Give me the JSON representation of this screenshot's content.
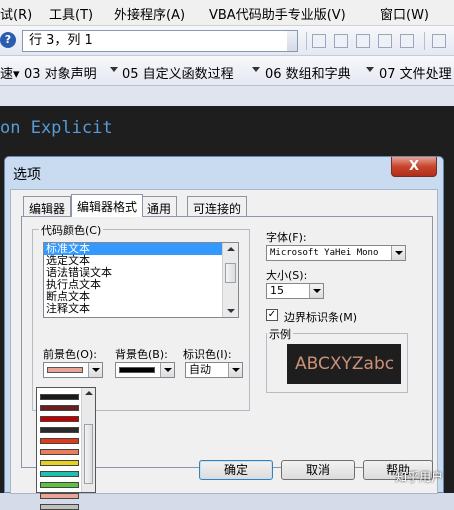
{
  "menubar": {
    "items": [
      "试(R)",
      "工具(T)",
      "外接程序(A)",
      "VBA代码助手专业版(V)",
      "窗口(W)"
    ]
  },
  "toolbar1": {
    "help_glyph": "?",
    "position_text": "行 3，列 1"
  },
  "toolbar2": {
    "items": [
      "速▾",
      "03 对象声明",
      "05 自定义函数过程",
      "06 数组和字典",
      "07 文件处理"
    ]
  },
  "editor": {
    "code_visible": "on Explicit"
  },
  "dialog": {
    "title": "选项",
    "close_glyph": "X",
    "tabs": [
      "编辑器",
      "编辑器格式",
      "通用",
      "可连接的"
    ],
    "active_tab": 1,
    "code_colors": {
      "group_label": "代码颜色(C)",
      "items": [
        "标准文本",
        "选定文本",
        "语法错误文本",
        "执行点文本",
        "断点文本",
        "注释文本"
      ],
      "selected_index": 0
    },
    "foreground": {
      "label": "前景色(O):",
      "swatch_color": "#e8a494"
    },
    "background": {
      "label": "背景色(B):",
      "swatch_color": "#000000"
    },
    "indicator": {
      "label": "标识色(I):",
      "value": "自动"
    },
    "font": {
      "label": "字体(F):",
      "value": "Microsoft YaHei Mono"
    },
    "size": {
      "label": "大小(S):",
      "value": "15"
    },
    "margin_indicator": {
      "label": "边界标识条(M)",
      "checked": true,
      "check_glyph": "✓"
    },
    "sample": {
      "group_label": "示例",
      "text": "ABCXYZabc"
    },
    "buttons": {
      "ok": "确定",
      "cancel": "取消",
      "help": "帮助"
    }
  },
  "color_popup": {
    "colors": [
      "#1a1a1a",
      "#6b1e1e",
      "#c00000",
      "#2a2a2a",
      "#e03a1a",
      "#e87f5a",
      "#e8d020",
      "#20c0b0",
      "#60c040",
      "#e8a494",
      "#c0c0c0"
    ]
  },
  "watermark": "知乎用户",
  "colors": {
    "editor_bg": "#1e1e1e",
    "keyword": "#569cd6",
    "string_sample": "#ce9178",
    "selection": "#3399ff"
  }
}
